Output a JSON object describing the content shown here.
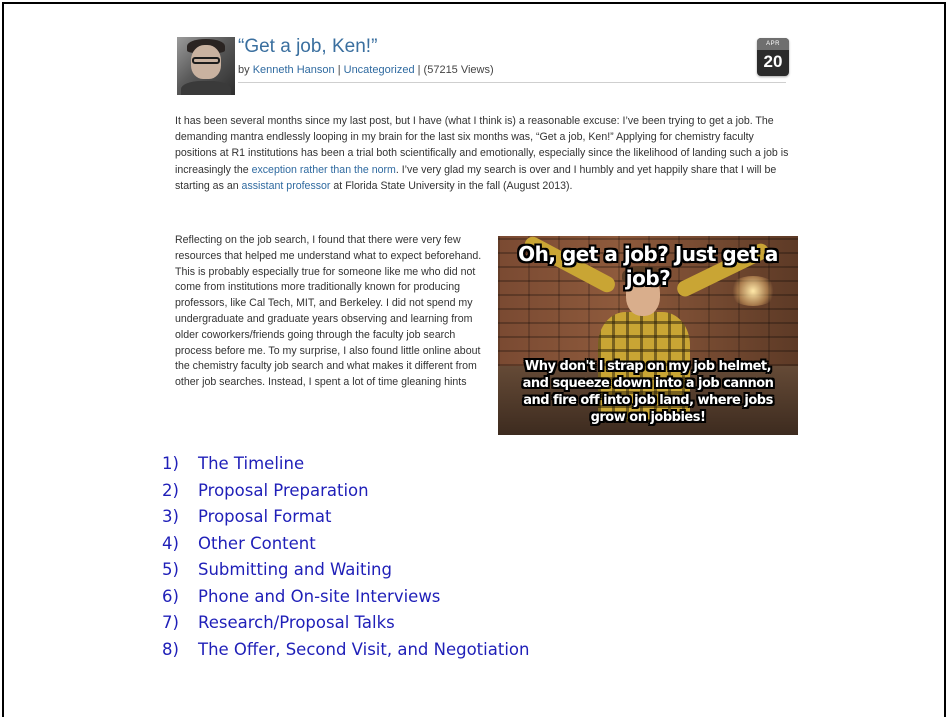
{
  "post": {
    "title": "“Get a job, Ken!”",
    "by_prefix": "by ",
    "author": "Kenneth Hanson",
    "separator1": " | ",
    "category": "Uncategorized",
    "separator2": " | ",
    "views": "(57215 Views)",
    "date": {
      "month": "APR",
      "day": "20"
    }
  },
  "paragraph1": {
    "text_before_link1": "It has been several months since my last post, but I have (what I think is) a reasonable excuse: I’ve been trying to get a job. The demanding mantra endlessly looping in my brain for the last six months was, “Get a job, Ken!” Applying for chemistry faculty positions at R1 institutions has been a trial both scientifically and emotionally, especially since the likelihood of landing such a job is increasingly the ",
    "link1": "exception rather than the norm",
    "text_between_links": ". I’ve very glad my search is over and I humbly and yet happily share that I will be starting as an ",
    "link2": "assistant professor",
    "text_after_link2": " at Florida State University in the fall (August 2013)."
  },
  "paragraph2": "Reflecting on the job search, I found that there were very few resources that helped me understand what to expect beforehand. This is probably especially true for someone like me who did not come from institutions more traditionally known for producing professors, like Cal Tech, MIT, and Berkeley. I did not spend my undergraduate and graduate years observing and learning from older coworkers/friends going through the faculty job search process before me. To my surprise, I also found little online about the chemistry faculty job search and what makes it different from other job searches. Instead, I spent a lot of time gleaning hints",
  "meme": {
    "top_caption": "Oh, get a job? Just get a job?",
    "bottom_caption": "Why don't I strap on my job helmet,\nand squeeze down into a job cannon\nand fire off into job land, where jobs\ngrow on jobbies!"
  },
  "outline": [
    {
      "num": "1)",
      "label": "The Timeline"
    },
    {
      "num": "2)",
      "label": "Proposal Preparation"
    },
    {
      "num": "3)",
      "label": "Proposal Format"
    },
    {
      "num": "4)",
      "label": "Other Content"
    },
    {
      "num": "5)",
      "label": "Submitting and Waiting"
    },
    {
      "num": "6)",
      "label": "Phone and On-site Interviews"
    },
    {
      "num": "7)",
      "label": "Research/Proposal Talks"
    },
    {
      "num": "8)",
      "label": "The Offer, Second Visit, and Negotiation"
    }
  ]
}
